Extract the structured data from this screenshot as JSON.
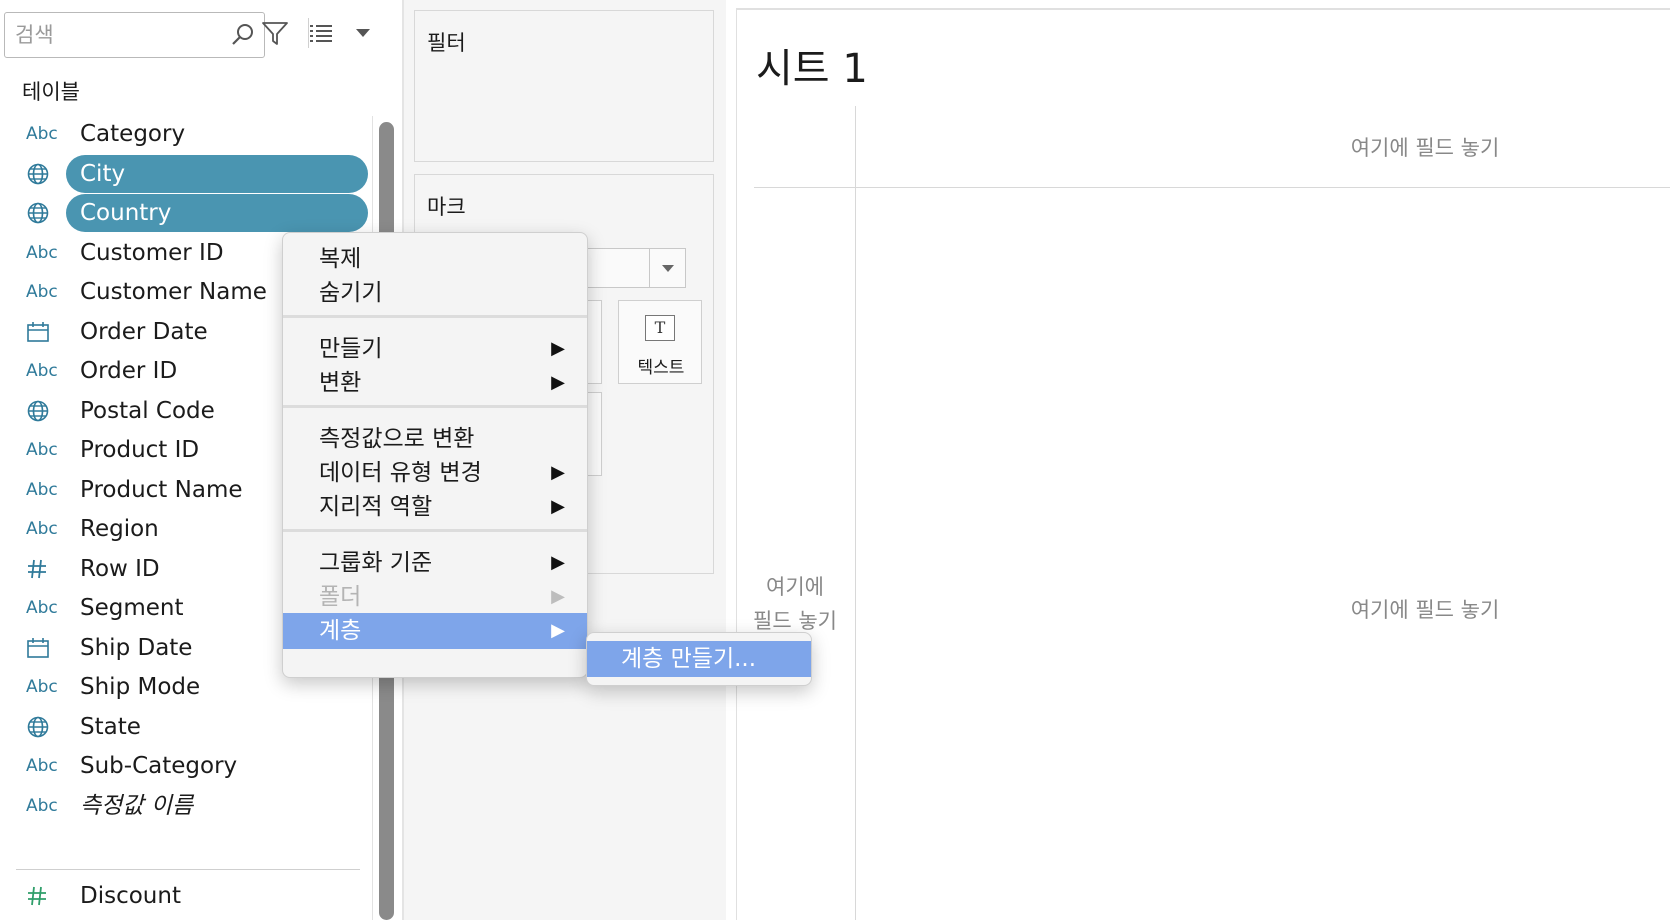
{
  "search": {
    "placeholder": "검색"
  },
  "tables_heading": "테이블",
  "fields": [
    {
      "type": "abc",
      "type_label": "Abc",
      "label": "Category",
      "selected": false
    },
    {
      "type": "geo",
      "type_label": "",
      "label": "City",
      "selected": true
    },
    {
      "type": "geo",
      "type_label": "",
      "label": "Country",
      "selected": true
    },
    {
      "type": "abc",
      "type_label": "Abc",
      "label": "Customer ID",
      "selected": false
    },
    {
      "type": "abc",
      "type_label": "Abc",
      "label": "Customer Name",
      "selected": false
    },
    {
      "type": "date",
      "type_label": "",
      "label": "Order Date",
      "selected": false
    },
    {
      "type": "abc",
      "type_label": "Abc",
      "label": "Order ID",
      "selected": false
    },
    {
      "type": "geo",
      "type_label": "",
      "label": "Postal Code",
      "selected": false
    },
    {
      "type": "abc",
      "type_label": "Abc",
      "label": "Product ID",
      "selected": false
    },
    {
      "type": "abc",
      "type_label": "Abc",
      "label": "Product Name",
      "selected": false
    },
    {
      "type": "abc",
      "type_label": "Abc",
      "label": "Region",
      "selected": false
    },
    {
      "type": "num",
      "type_label": "",
      "label": "Row ID",
      "selected": false
    },
    {
      "type": "abc",
      "type_label": "Abc",
      "label": "Segment",
      "selected": false
    },
    {
      "type": "date",
      "type_label": "",
      "label": "Ship Date",
      "selected": false
    },
    {
      "type": "abc",
      "type_label": "Abc",
      "label": "Ship Mode",
      "selected": false
    },
    {
      "type": "geo",
      "type_label": "",
      "label": "State",
      "selected": false
    },
    {
      "type": "abc",
      "type_label": "Abc",
      "label": "Sub-Category",
      "selected": false
    },
    {
      "type": "abc",
      "type_label": "Abc",
      "label": "측정값 이름",
      "selected": false,
      "italic": true
    }
  ],
  "measures": [
    {
      "type": "num-measure",
      "type_label": "",
      "label": "Discount"
    }
  ],
  "shelves": {
    "filters_title": "필터",
    "marks_title": "마크",
    "text_mark_label": "텍스트",
    "text_mark_glyph": "T"
  },
  "view": {
    "sheet_title": "시트 1",
    "columns_hint": "여기에 필드 놓기",
    "rows_hint_line1": "여기에",
    "rows_hint_line2": "필드 놓기",
    "body_hint": "여기에 필드 놓기"
  },
  "context_menu": {
    "groups": [
      [
        {
          "label": "복제",
          "submenu": false,
          "disabled": false
        },
        {
          "label": "숨기기",
          "submenu": false,
          "disabled": false
        }
      ],
      [
        {
          "label": "만들기",
          "submenu": true,
          "disabled": false
        },
        {
          "label": "변환",
          "submenu": true,
          "disabled": false
        }
      ],
      [
        {
          "label": "측정값으로 변환",
          "submenu": false,
          "disabled": false
        },
        {
          "label": "데이터 유형 변경",
          "submenu": true,
          "disabled": false
        },
        {
          "label": "지리적 역할",
          "submenu": true,
          "disabled": false
        }
      ],
      [
        {
          "label": "그룹화 기준",
          "submenu": true,
          "disabled": false
        },
        {
          "label": "폴더",
          "submenu": true,
          "disabled": true
        },
        {
          "label": "계층",
          "submenu": true,
          "disabled": false,
          "highlighted": true
        }
      ]
    ],
    "submenu_arrow": "▶"
  },
  "submenu": {
    "item_label": "계층 만들기..."
  },
  "colors": {
    "selected_pill": "#4a95b1",
    "menu_highlight": "#7ea5ea",
    "type_icon": "#2f7a9a",
    "measure_icon": "#2f9e6a"
  }
}
